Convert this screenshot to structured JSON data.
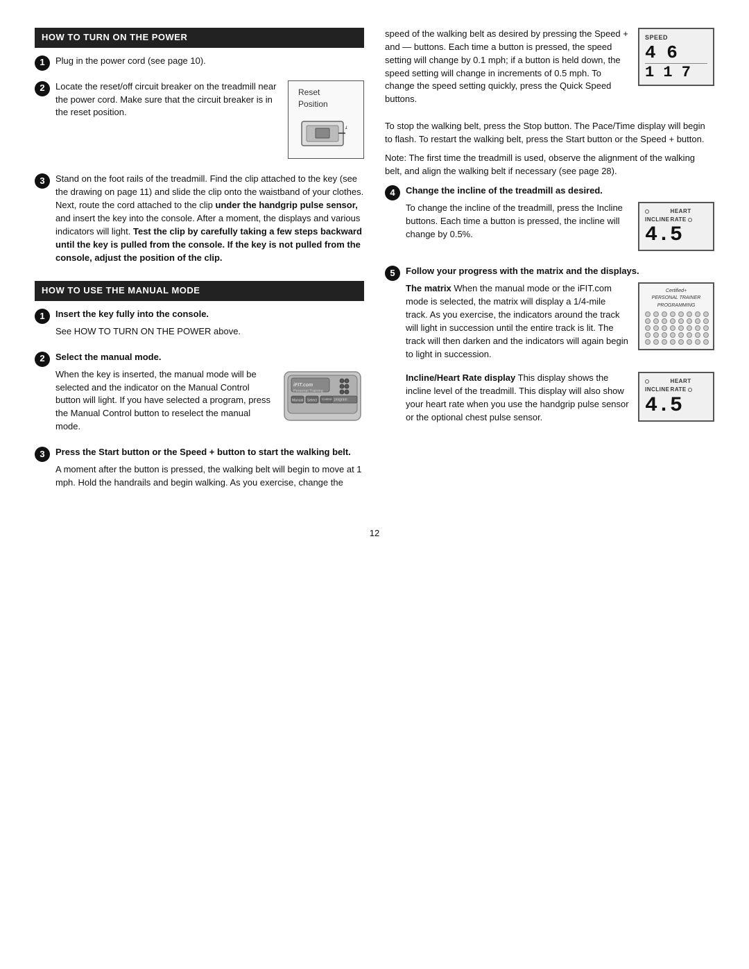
{
  "page": {
    "number": "12"
  },
  "section_power": {
    "title": "HOW TO TURN ON THE POWER",
    "step1": {
      "num": "1",
      "text": "Plug in the power cord (see page 10)."
    },
    "step2": {
      "num": "2",
      "text_before": "Locate the reset/off circuit breaker on the treadmill near the power cord. Make sure that the circuit breaker is in the reset position.",
      "image_label": "Reset\nPosition"
    },
    "step3": {
      "num": "3",
      "text": "Stand on the foot rails of the treadmill. Find the clip attached to the key (see the drawing on page 11) and slide the clip onto the waistband of your clothes. Next, route the cord attached to the clip ",
      "bold_part": "under the handgrip pulse sensor,",
      "text2": " and insert the key into the console. After a moment, the displays and various indicators will light. ",
      "bold_part2": "Test the clip by carefully taking a few steps backward until the key is pulled from the console. If the key is not pulled from the console, adjust the position of the clip."
    }
  },
  "section_manual": {
    "title": "HOW TO USE THE MANUAL MODE",
    "step1": {
      "num": "1",
      "label": "Insert the key fully into the console.",
      "text": "See HOW TO TURN ON THE POWER above."
    },
    "step2": {
      "num": "2",
      "label": "Select the manual mode.",
      "text": "When the key is inserted, the manual mode will be selected and the indicator on the Manual Control button will light. If you have selected a program, press the Manual Control button to reselect the manual mode."
    },
    "step3": {
      "num": "3",
      "label": "Press the Start button or the Speed + button to start the walking belt.",
      "text": "A moment after the button is pressed, the walking belt will begin to move at 1 mph. Hold the handrails and begin walking. As you exercise, change the"
    },
    "speed_text": "speed of the walking belt as desired by pressing the Speed + and — buttons. Each time a button is pressed, the speed setting will change by 0.1 mph; if a button is held down, the speed setting will change in increments of 0.5 mph. To change the speed setting quickly, press the Quick Speed buttons.",
    "stop_text": "To stop the walking belt, press the Stop button. The Pace/Time display will begin to flash. To restart the walking belt, press the Start button or the Speed + button.",
    "note_text": "Note: The first time the treadmill is used, observe the alignment of the walking belt, and align the walking belt if necessary (see page 28)."
  },
  "section_right": {
    "step4": {
      "num": "4",
      "label": "Change the incline of the treadmill as desired.",
      "text": "To change the incline of the treadmill, press the Incline buttons. Each time a button is pressed, the incline will change by 0.5%."
    },
    "step5": {
      "num": "5",
      "label": "Follow your progress with the matrix and the displays.",
      "matrix_text": "The matrix",
      "matrix_text2": " When the manual mode or the iFIT.com mode is selected, the matrix will display a 1/4-mile track. As you exercise, the indicators around the track will light in succession until the entire track is lit. The track will then darken and the indicators will again begin to light in succession.",
      "incline_hr_title": "Incline/Heart Rate display",
      "incline_hr_text": " This display shows the incline level of the treadmill. This display will also show your heart rate when you use the handgrip pulse sensor or the optional chest pulse sensor."
    },
    "speed_display": {
      "label": "SPEED",
      "num1": "46",
      "num2": "1 1 7"
    },
    "incline_display1": {
      "label1": "INCLINE",
      "label2": "HEART RATE",
      "num": "4.5"
    },
    "incline_display2": {
      "label1": "INCLINE",
      "label2": "HEART RATE",
      "num": "4.5"
    }
  }
}
